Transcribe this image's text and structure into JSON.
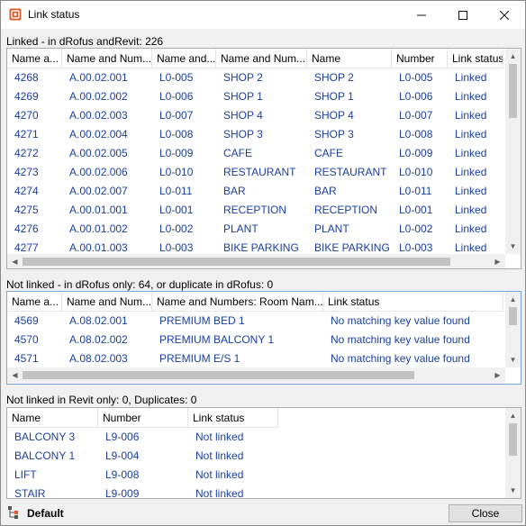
{
  "window": {
    "title": "Link status"
  },
  "linked": {
    "label": "Linked - in dRofus andRevit: 226",
    "columns": [
      "Name a...",
      "Name and Num...",
      "Name and...",
      "Name and Num...",
      "Name",
      "Number",
      "Link status"
    ],
    "rows": [
      [
        "4268",
        "A.00.02.001",
        "L0-005",
        "SHOP 2",
        "SHOP 2",
        "L0-005",
        "Linked"
      ],
      [
        "4269",
        "A.00.02.002",
        "L0-006",
        "SHOP 1",
        "SHOP 1",
        "L0-006",
        "Linked"
      ],
      [
        "4270",
        "A.00.02.003",
        "L0-007",
        "SHOP 4",
        "SHOP 4",
        "L0-007",
        "Linked"
      ],
      [
        "4271",
        "A.00.02.004",
        "L0-008",
        "SHOP 3",
        "SHOP 3",
        "L0-008",
        "Linked"
      ],
      [
        "4272",
        "A.00.02.005",
        "L0-009",
        "CAFE",
        "CAFE",
        "L0-009",
        "Linked"
      ],
      [
        "4273",
        "A.00.02.006",
        "L0-010",
        "RESTAURANT",
        "RESTAURANT",
        "L0-010",
        "Linked"
      ],
      [
        "4274",
        "A.00.02.007",
        "L0-011",
        "BAR",
        "BAR",
        "L0-011",
        "Linked"
      ],
      [
        "4275",
        "A.00.01.001",
        "L0-001",
        "RECEPTION",
        "RECEPTION",
        "L0-001",
        "Linked"
      ],
      [
        "4276",
        "A.00.01.002",
        "L0-002",
        "PLANT",
        "PLANT",
        "L0-002",
        "Linked"
      ],
      [
        "4277",
        "A.00.01.003",
        "L0-003",
        "BIKE PARKING",
        "BIKE PARKING",
        "L0-003",
        "Linked"
      ]
    ]
  },
  "not_linked": {
    "label": "Not linked - in dRofus only: 64, or duplicate in dRofus: 0",
    "columns": [
      "Name a...",
      "Name and Num...",
      "Name and Numbers: Room Nam...",
      "Link status"
    ],
    "rows": [
      [
        "4569",
        "A.08.02.001",
        "PREMIUM BED 1",
        "No matching key value found"
      ],
      [
        "4570",
        "A.08.02.002",
        "PREMIUM BALCONY 1",
        "No matching key value found"
      ],
      [
        "4571",
        "A.08.02.003",
        "PREMIUM E/S 1",
        "No matching key value found"
      ]
    ]
  },
  "revit_only": {
    "label": "Not linked in Revit only: 0, Duplicates: 0",
    "columns": [
      "Name",
      "Number",
      "Link status"
    ],
    "rows": [
      [
        "BALCONY 3",
        "L9-006",
        "Not linked"
      ],
      [
        "BALCONY 1",
        "L9-004",
        "Not linked"
      ],
      [
        "LIFT",
        "L9-008",
        "Not linked"
      ],
      [
        "STAIR",
        "L9-009",
        "Not linked"
      ]
    ]
  },
  "footer": {
    "default_label": "Default",
    "close_label": "Close"
  },
  "colors": {
    "cell_text": "#1a3f9e",
    "window_bg": "#f0f0f0",
    "grid_border": "#adadad",
    "app_icon": "#e05a28"
  },
  "icons": {
    "app": "drofus-app-icon",
    "minimize": "minimize-icon",
    "maximize": "maximize-icon",
    "close": "close-icon",
    "default": "tree-hierarchy-icon"
  }
}
